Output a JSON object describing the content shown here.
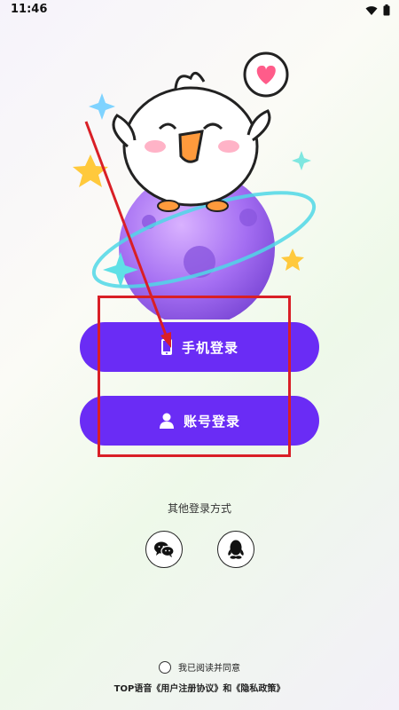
{
  "status_bar": {
    "time": "11:46"
  },
  "login": {
    "phone_button_label": "手机登录",
    "account_button_label": "账号登录",
    "other_methods_title": "其他登录方式",
    "wechat_icon": "wechat-icon",
    "qq_icon": "qq-icon"
  },
  "agreement": {
    "consent_text": "我已阅读并同意",
    "prefix": "TOP语音",
    "user_agreement": "《用户注册协议》",
    "conjunction": "和",
    "privacy_policy": "《隐私政策》"
  },
  "colors": {
    "primary": "#6a2cf5",
    "annotation_red": "#d91f26"
  }
}
